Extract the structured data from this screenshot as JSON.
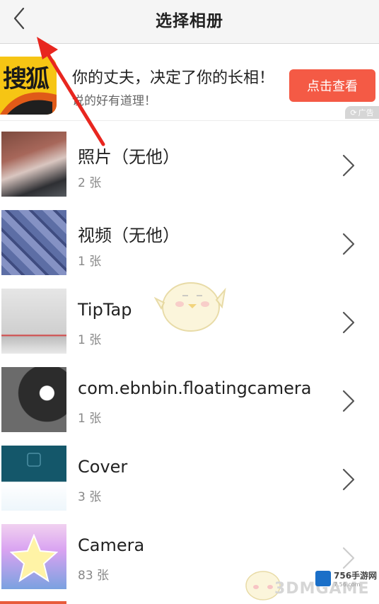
{
  "header": {
    "title": "选择相册",
    "back_icon": "chevron-left-icon"
  },
  "ad": {
    "logo_text": "搜狐",
    "headline": "你的丈夫，决定了你的长相！",
    "subtitle": "说的好有道理！",
    "cta_label": "点击查看",
    "tag_label": "广告",
    "colors": {
      "cta": "#f45a45",
      "logo": "#f6c514"
    }
  },
  "albums": [
    {
      "name": "照片（无他）",
      "count": "2 张"
    },
    {
      "name": "视频（无他）",
      "count": "1 张"
    },
    {
      "name": "TipTap",
      "count": "1 张"
    },
    {
      "name": "com.ebnbin.floatingcamera",
      "count": "1 张"
    },
    {
      "name": "Cover",
      "count": "3 张"
    },
    {
      "name": "Camera",
      "count": "83 张"
    }
  ],
  "watermark": {
    "text": "3DMGAME",
    "badge": "756手游网",
    "badge_sub": "7.56.com"
  }
}
